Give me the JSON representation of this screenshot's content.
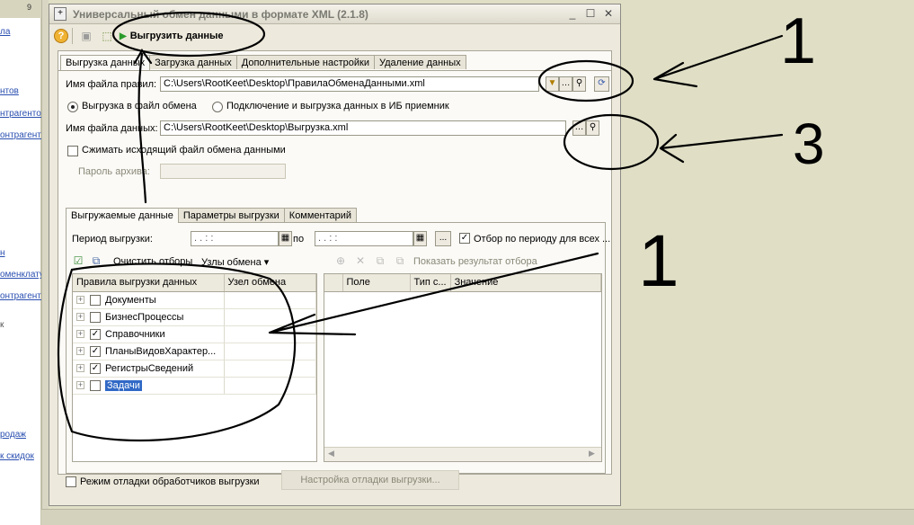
{
  "window": {
    "title": "Универсальный обмен данными в формате XML (2.1.8)",
    "controls": [
      "_",
      "☐",
      "✕"
    ]
  },
  "toolbar": {
    "help_icon": "help-icon",
    "export_label": "Выгрузить данные"
  },
  "main_tabs": [
    "Выгрузка данных",
    "Загрузка данных",
    "Дополнительные настройки",
    "Удаление данных"
  ],
  "rules_file": {
    "label": "Имя файла правил:",
    "value": "C:\\Users\\RootKeet\\Desktop\\ПравилаОбменаДанными.xml"
  },
  "mode": {
    "option_file": "Выгрузка в файл обмена",
    "option_ib": "Подключение и выгрузка данных в ИБ приемник",
    "selected": "option_file"
  },
  "data_file": {
    "label": "Имя файла данных:",
    "value": "C:\\Users\\RootKeet\\Desktop\\Выгрузка.xml"
  },
  "compress": {
    "label": "Сжимать исходящий файл обмена данными",
    "checked": false
  },
  "archive_password": {
    "label": "Пароль архива:",
    "value": ""
  },
  "inner_tabs": [
    "Выгружаемые данные",
    "Параметры выгрузки",
    "Комментарий"
  ],
  "period": {
    "label": "Период выгрузки:",
    "from": " .  .     :  :",
    "to_label": "по",
    "to": " .  .     :  :",
    "more": "...",
    "filter_label": "Отбор по периоду для всех ...",
    "filter_checked": true
  },
  "rules_toolbar": {
    "clear_filters": "Очистить отборы",
    "exchange_nodes": "Узлы обмена ▾"
  },
  "rules_table": {
    "headers": [
      "Правила выгрузки данных",
      "Узел обмена"
    ],
    "rows": [
      {
        "name": "Документы",
        "checked": false
      },
      {
        "name": "БизнесПроцессы",
        "checked": false
      },
      {
        "name": "Справочники",
        "checked": true
      },
      {
        "name": "ПланыВидовХарактер...",
        "checked": true
      },
      {
        "name": "РегистрыСведений",
        "checked": true
      },
      {
        "name": "Задачи",
        "checked": false
      }
    ]
  },
  "filter_toolbar": {
    "show_result": "Показать результат отбора"
  },
  "filter_table": {
    "headers": [
      "Поле",
      "Тип с...",
      "Значение"
    ]
  },
  "debug": {
    "label": "Режим отладки обработчиков выгрузки",
    "button": "Настройка отладки выгрузки..."
  },
  "background": {
    "links": [
      "ла",
      "нтов",
      "нтрагентов",
      "онтрагентов",
      "н",
      "оменклатура",
      "онтрагентов",
      "к",
      "родаж",
      "к скидок"
    ]
  },
  "annotations": [
    "1",
    "3",
    "1"
  ]
}
